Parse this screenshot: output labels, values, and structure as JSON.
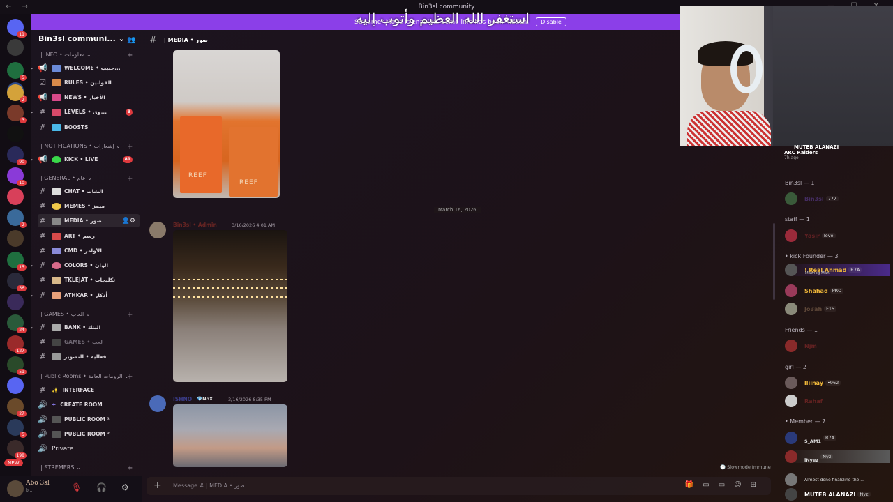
{
  "window": {
    "title": "Bin3sl community"
  },
  "banner": {
    "text": "Streamer Mode is enabled. Some info has been hidden.",
    "disable_label": "Disable",
    "overlay_arabic": "استغفر الله العظيم وأتوب إليه"
  },
  "rail": {
    "servers": [
      {
        "badge": "11",
        "color": "#5865f2"
      },
      {
        "badge": "",
        "color": "#3a3a3a"
      },
      {
        "badge": "5",
        "color": "#1f6f3f"
      },
      {
        "badge": "3",
        "color": "#2c4a8a"
      },
      {
        "badge": "2",
        "color": "#d4a23a"
      },
      {
        "badge": "3",
        "color": "#7a3a2a"
      },
      {
        "badge": "",
        "color": "#111111"
      },
      {
        "badge": "90",
        "color": "#2a2a5a"
      },
      {
        "badge": "10",
        "color": "#8a3ad8"
      },
      {
        "badge": "",
        "color": "#d8405a"
      },
      {
        "badge": "2",
        "color": "#3a6a9a"
      },
      {
        "badge": "",
        "color": "#4a3a2a"
      },
      {
        "badge": "15",
        "color": "#1f6f3f"
      },
      {
        "badge": "36",
        "color": "#2a2a3a"
      },
      {
        "badge": "",
        "color": "#3a2a5a"
      },
      {
        "badge": "24",
        "color": "#2a5a3a"
      },
      {
        "badge": "127",
        "color": "#9a2a2a"
      },
      {
        "badge": "51",
        "color": "#2a4a2a"
      },
      {
        "badge": "",
        "color": "#5865f2"
      },
      {
        "badge": "27",
        "color": "#6a4a2a"
      },
      {
        "badge": "5",
        "color": "#2a3a5a"
      },
      {
        "badge": "198",
        "color": "#3a2a2a"
      }
    ],
    "new_label": "NEW"
  },
  "sidebar": {
    "server_name": "Bin3sl communi...",
    "categories": [
      {
        "label": "| INFO • معلومات"
      },
      {
        "label": "| NOTIFICATIONS • إشعارات"
      },
      {
        "label": "| GENERAL • عام"
      },
      {
        "label": "| GAMES • العاب"
      },
      {
        "label": "| Public Rooms • الرومات العامة"
      },
      {
        "label": "| STREMERS"
      }
    ],
    "channels": [
      {
        "label": "WELCOME • حبيب...",
        "count": ""
      },
      {
        "label": "RULES • القوانين",
        "count": ""
      },
      {
        "label": "NEWS • الأخبار",
        "count": ""
      },
      {
        "label": "LEVELS • وى...",
        "count": "9"
      },
      {
        "label": "BOOSTS",
        "count": ""
      },
      {
        "label": "KICK • LIVE",
        "count": "81"
      },
      {
        "label": "CHAT • الشات",
        "count": ""
      },
      {
        "label": "MEMES • ميمز",
        "count": ""
      },
      {
        "label": "MEDIA • صور",
        "count": ""
      },
      {
        "label": "ART • رسم",
        "count": ""
      },
      {
        "label": "CMD • الأوامر",
        "count": ""
      },
      {
        "label": "COLORS • الوان",
        "count": ""
      },
      {
        "label": "TKLEJAT • تكليجات",
        "count": ""
      },
      {
        "label": "ATHKAR • أذكار",
        "count": ""
      },
      {
        "label": "BANK • البنك",
        "count": ""
      },
      {
        "label": "GAMES • لعب",
        "count": ""
      },
      {
        "label": "فعالية • التصوير",
        "count": ""
      },
      {
        "label": "INTERFACE",
        "count": ""
      },
      {
        "label": "CREATE ROOM",
        "count": ""
      },
      {
        "label": "PUBLIC ROOM ¹",
        "count": ""
      },
      {
        "label": "PUBLIC ROOM ²",
        "count": ""
      },
      {
        "label": "Private",
        "count": ""
      }
    ]
  },
  "user": {
    "name": "Abo 3sl",
    "status": "b..."
  },
  "header": {
    "channel": "| MEDIA • صور"
  },
  "messages": {
    "date_divider": "March 16, 2026",
    "msg1": {
      "author": "Bin3sl • Admin",
      "timestamp": "3/16/2026 4:01 AM"
    },
    "msg2": {
      "author": "ISHNO",
      "badge": "NoX",
      "timestamp": "3/16/2026 8:35 PM"
    },
    "image1_caption": "REEF"
  },
  "composer": {
    "placeholder": "Message # | MEDIA • صور"
  },
  "slowmode": "Slowmode Immune",
  "members": {
    "activity_name": "MUTEB ALANAZI",
    "activity_game": "ARC Raiders",
    "activity_time": "7h ago",
    "groups": [
      {
        "label": "Bin3sl — 1"
      },
      {
        "label": "staff — 1"
      },
      {
        "label": "• kick Founder — 3"
      },
      {
        "label": "Friends — 1"
      },
      {
        "label": "girl — 2"
      },
      {
        "label": "• Member — 7"
      }
    ],
    "list": [
      {
        "name": "Bin3sl",
        "badge": "777",
        "color": "#8a5cf0"
      },
      {
        "name": "Yasir",
        "badge": "love",
        "color": "#e03a3e"
      },
      {
        "name": "! Real Ahmad",
        "badge": "R7A",
        "sub": "Maznog Man",
        "color": "#f0b83a"
      },
      {
        "name": "Shahad",
        "badge": "PRO",
        "color": "#f0b83a"
      },
      {
        "name": "Jo3ah",
        "badge": "F15",
        "color": "#c9a27a"
      },
      {
        "name": "Njm",
        "badge": "",
        "color": "#e03a3e"
      },
      {
        "name": "lliinay",
        "badge": "•962",
        "color": "#f0b83a"
      },
      {
        "name": "Rahaf",
        "badge": "",
        "color": "#e03a3e"
      },
      {
        "name": "S_AM1",
        "badge": "R7A",
        "color": "#8a5cf0"
      },
      {
        "name": "iNyez",
        "badge": "Nyz",
        "color": "#ddd"
      },
      {
        "name": "Almost done finalizing the ...",
        "badge": "",
        "color": "#ddd"
      },
      {
        "name": "MUTEB ALANAZI",
        "badge": "Nyz",
        "color": "#ffffff"
      }
    ]
  }
}
